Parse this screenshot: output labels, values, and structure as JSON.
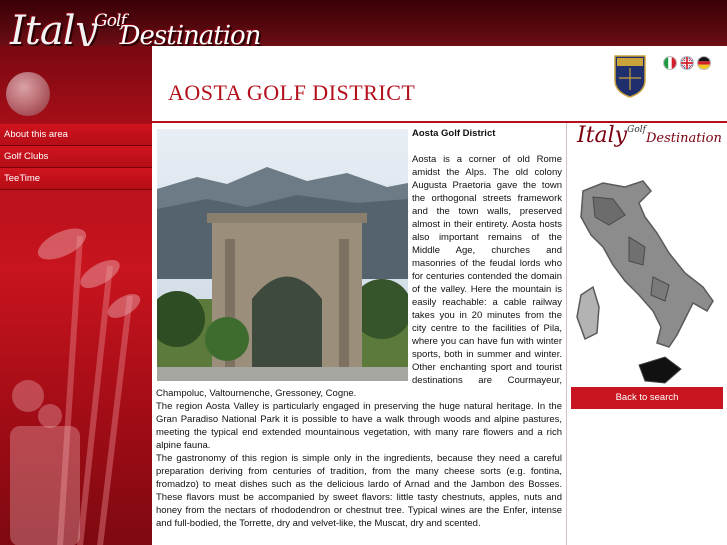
{
  "header": {
    "logo_main": "Italy",
    "logo_golf": "Golf",
    "logo_dest": "Destination",
    "page_title": "AOSTA GOLF DISTRICT"
  },
  "languages": [
    {
      "code": "it",
      "icon": "italian-flag-icon"
    },
    {
      "code": "en",
      "icon": "uk-flag-icon"
    },
    {
      "code": "de",
      "icon": "german-flag-icon"
    }
  ],
  "sidebar": {
    "items": [
      {
        "label": "About this area"
      },
      {
        "label": "Golf Clubs"
      },
      {
        "label": "TeeTime"
      }
    ]
  },
  "article": {
    "title": "Aosta Golf District",
    "paragraphs": [
      "Aosta is a corner of old Rome amidst the Alps. The old colony Augusta Praetoria gave the town the orthogonal streets framework and the town walls, preserved almost in their entirety. Aosta hosts also important remains of the Middle Age, churches and masonries of the feudal lords who for centuries contended the domain of the valley. Here the mountain is easily reachable: a cable railway takes you in 20 minutes from the city centre to the facilities of Pila, where you can have fun with winter sports, both in summer and winter. Other enchanting sport and tourist destinations are Courmayeur, Champoluc, Valtournenche, Gressoney, Cogne.",
      "The region Aosta Valley is particularly engaged in preserving the huge natural heritage. In the Gran Paradiso National Park it is possible to have a walk through woods and alpine pastures, meeting the typical end extended mountainous vegetation, with many rare flowers and a rich alpine fauna.",
      "The gastronomy of this region is simple only in the ingredients, because they need a careful preparation deriving from centuries of tradition, from the many cheese sorts (e.g. fontina, fromadzo) to meat dishes such as the delicious lardo of Arnad and the Jambon des Bosses. These flavors must be accompanied by sweet flavors: little tasty chestnuts, apples, nuts and honey from the nectars of rhododendron or chestnut tree. Typical wines are the Enfer, intense and full-bodied, the Torrette, dry and velvet-like, the Muscat, dry and scented."
    ]
  },
  "rightcol": {
    "logo_main": "Italy",
    "logo_golf": "Golf",
    "logo_dest": "Destination",
    "back_label": "Back to search"
  },
  "colors": {
    "brand_red": "#b3101b",
    "dark_maroon": "#3a0006"
  }
}
